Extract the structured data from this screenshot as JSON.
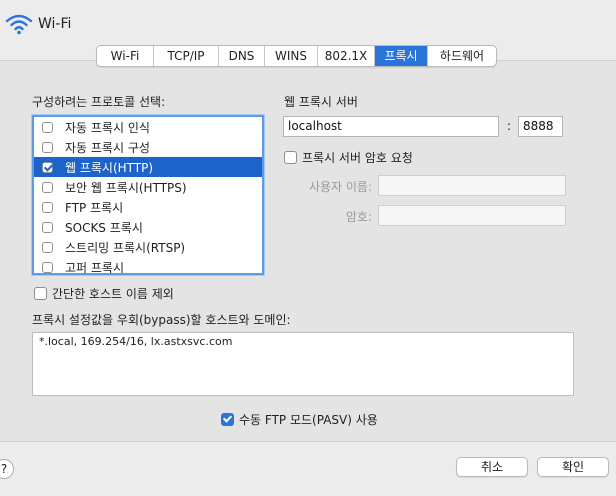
{
  "window": {
    "title": "Wi-Fi"
  },
  "tabs": [
    {
      "label": "Wi-Fi"
    },
    {
      "label": "TCP/IP"
    },
    {
      "label": "DNS"
    },
    {
      "label": "WINS"
    },
    {
      "label": "802.1X"
    },
    {
      "label": "프록시"
    },
    {
      "label": "하드웨어"
    }
  ],
  "selected_tab": "프록시",
  "protocol_section": {
    "label": "구성하려는 프로토콜 선택:",
    "items": [
      {
        "label": "자동 프록시 인식",
        "checked": false,
        "selected": false
      },
      {
        "label": "자동 프록시 구성",
        "checked": false,
        "selected": false
      },
      {
        "label": "웹 프록시(HTTP)",
        "checked": true,
        "selected": true
      },
      {
        "label": "보안 웹 프록시(HTTPS)",
        "checked": false,
        "selected": false
      },
      {
        "label": "FTP 프록시",
        "checked": false,
        "selected": false
      },
      {
        "label": "SOCKS 프록시",
        "checked": false,
        "selected": false
      },
      {
        "label": "스트리밍 프록시(RTSP)",
        "checked": false,
        "selected": false
      },
      {
        "label": "고퍼 프록시",
        "checked": false,
        "selected": false
      }
    ]
  },
  "simple_hostnames": {
    "label": "간단한 호스트 이름 제외",
    "checked": false
  },
  "web_proxy_server": {
    "label": "웹 프록시 서버",
    "host": "localhost",
    "separator": ":",
    "port": "8888",
    "password_required": {
      "label": "프록시 서버 암호 요청",
      "checked": false
    },
    "username_label": "사용자 이름:",
    "username_value": "",
    "password_label": "암호:",
    "password_value": ""
  },
  "bypass": {
    "label": "프록시 설정값을 우회(bypass)할 호스트와 도메인:",
    "value": "*.local, 169.254/16, lx.astxsvc.com"
  },
  "passive_ftp": {
    "label": "수동 FTP 모드(PASV) 사용",
    "checked": true
  },
  "buttons": {
    "help": "?",
    "cancel": "취소",
    "ok": "확인"
  },
  "colors": {
    "accent": "#2b74d8",
    "selection": "#1e63c9",
    "focus_ring": "#5b9bea"
  }
}
